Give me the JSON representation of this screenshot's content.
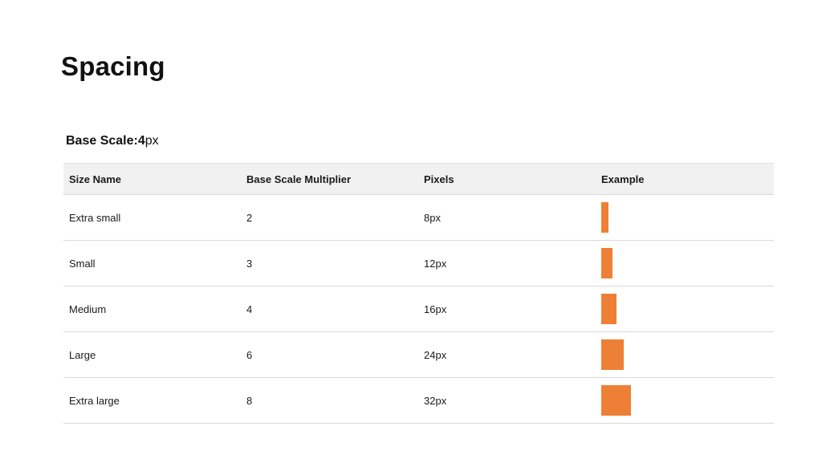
{
  "title": "Spacing",
  "base_scale": {
    "label": "Base Scale:",
    "value": "4",
    "unit": "px"
  },
  "table": {
    "headers": [
      "Size Name",
      "Base Scale Multiplier",
      "Pixels",
      "Example"
    ],
    "rows": [
      {
        "name": "Extra small",
        "multiplier": "2",
        "pixels": "8px",
        "example_size": 8
      },
      {
        "name": "Small",
        "multiplier": "3",
        "pixels": "12px",
        "example_size": 12
      },
      {
        "name": "Medium",
        "multiplier": "4",
        "pixels": "16px",
        "example_size": 16
      },
      {
        "name": "Large",
        "multiplier": "6",
        "pixels": "24px",
        "example_size": 24
      },
      {
        "name": "Extra large",
        "multiplier": "8",
        "pixels": "32px",
        "example_size": 32
      }
    ]
  },
  "colors": {
    "swatch": "#ee7f36",
    "header_bg": "#f1f1f1"
  }
}
